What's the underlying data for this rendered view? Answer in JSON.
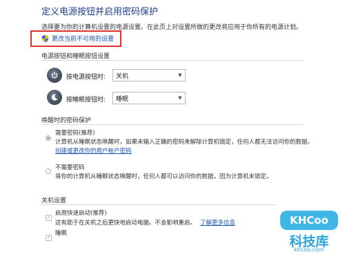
{
  "header": {
    "title": "定义电源按钮并启用密码保护",
    "description": "选择要为你的计算机设置的电源设置。在此页上对设置所做的更改将应用于你所有的电源计划。",
    "change_link": "更改当前不可用的设置"
  },
  "power_buttons": {
    "section_title": "电源按钮和睡眠按钮设置",
    "rows": [
      {
        "label": "按电源按钮时:",
        "value": "关机",
        "icon": "power-icon"
      },
      {
        "label": "按睡眠按钮时:",
        "value": "睡眠",
        "icon": "sleep-icon"
      }
    ]
  },
  "password": {
    "section_title": "唤醒时的密码保护",
    "option1": {
      "label": "需要密码(推荐)",
      "desc": "计算机从睡眠状态唤醒时，如果未输入正确的密码来解除计算机锁定，任何人都无法访问你的数据。",
      "link": "创建或更改你的用户帐户密码"
    },
    "option2": {
      "label": "不需要密码",
      "desc": "将你的计算机从睡眠状态唤醒时，任何人都可以访问你的数据，因为计算机未锁定。"
    }
  },
  "shutdown": {
    "section_title": "关机设置",
    "fast_startup": {
      "label": "启用快速启动(推荐)",
      "desc": "这有助于在关机之后更快地启动电脑。不会影响重启。",
      "link": "了解更多信息"
    },
    "sleep_label": "睡眠"
  },
  "watermark": {
    "logo": "KHCoo",
    "cn": "科技库",
    "url": "khcoo.com"
  }
}
